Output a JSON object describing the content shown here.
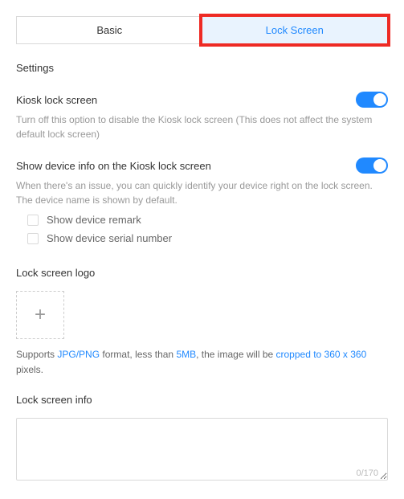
{
  "tabs": {
    "basic": "Basic",
    "lockScreen": "Lock Screen"
  },
  "sectionTitle": "Settings",
  "kioskLock": {
    "label": "Kiosk lock screen",
    "desc": "Turn off this option to disable the Kiosk lock screen (This does not affect the system default lock screen)"
  },
  "deviceInfo": {
    "label": "Show device info on the Kiosk lock screen",
    "desc": "When there's an issue, you can quickly identify your device right on the lock screen. The device name is shown by default.",
    "remark": "Show device remark",
    "serial": "Show device serial number"
  },
  "logo": {
    "title": "Lock screen logo",
    "hint_pre": "Supports ",
    "hint_fmt": "JPG/PNG",
    "hint_mid1": " format, less than ",
    "hint_size": "5MB",
    "hint_mid2": ", the image will be ",
    "hint_crop": "cropped to 360 x 360",
    "hint_post": " pixels."
  },
  "info": {
    "title": "Lock screen info",
    "counter": "0/170"
  }
}
